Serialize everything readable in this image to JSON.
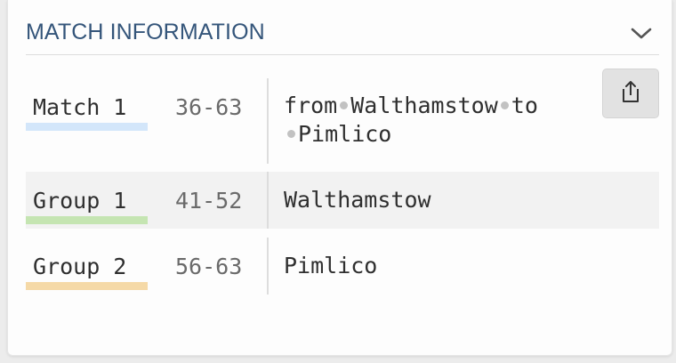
{
  "panel": {
    "title": "MATCH INFORMATION",
    "collapse_icon": "chevron-down-icon",
    "share_icon": "share-icon"
  },
  "rows": [
    {
      "label": "Match 1",
      "range": "36-63",
      "description_parts": [
        "from",
        "Walthamstow",
        "to",
        "Pimlico"
      ],
      "color": "#d3e6fa"
    },
    {
      "label": "Group 1",
      "range": "41-52",
      "description": "Walthamstow",
      "color": "#c5e5b2"
    },
    {
      "label": "Group 2",
      "range": "56-63",
      "description": "Pimlico",
      "color": "#f5d9a7"
    }
  ]
}
